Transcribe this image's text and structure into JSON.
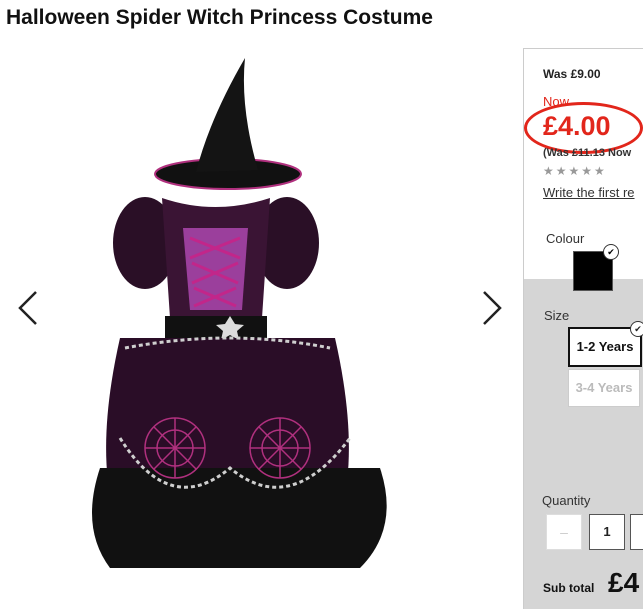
{
  "product": {
    "title": "Halloween Spider Witch Princess Costume"
  },
  "pricing": {
    "was": "Was £9.00",
    "now_label": "Now",
    "now_price": "£4.00",
    "was_now_note": "(Was £11.13 Now",
    "rating_stars": "★★★★★",
    "review_link": "Write the first re"
  },
  "options": {
    "colour_label": "Colour",
    "colour_value": "#000000",
    "size_label": "Size",
    "sizes": [
      "1-2 Years",
      "3-4 Years"
    ]
  },
  "quantity": {
    "label": "Quantity",
    "minus": "–",
    "value": "1"
  },
  "subtotal": {
    "label": "Sub total",
    "value": "£4"
  },
  "colors": {
    "accent": "#e2261b",
    "dress_purple": "#9b3f9c",
    "dress_black": "#111111"
  }
}
